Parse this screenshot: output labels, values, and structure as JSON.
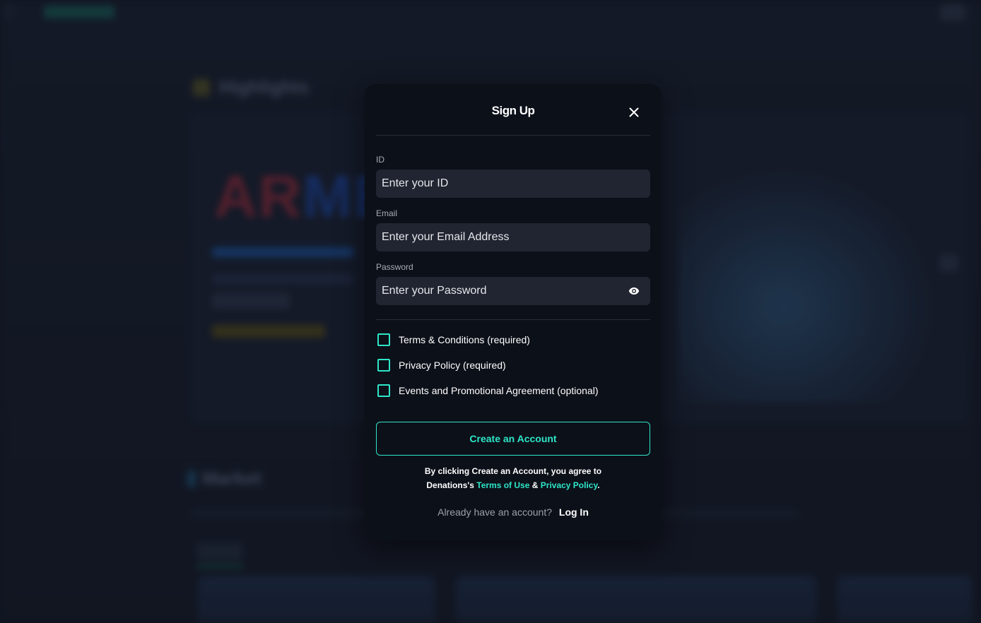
{
  "background": {
    "section_title_1": "Highlights",
    "hero_word_red": "AR",
    "hero_word_blue": "ME",
    "section_title_2": "Market"
  },
  "modal": {
    "title": "Sign Up",
    "close_icon": "close-icon",
    "fields": {
      "id": {
        "label": "ID",
        "placeholder": "Enter your ID",
        "value": ""
      },
      "email": {
        "label": "Email",
        "placeholder": "Enter your Email Address",
        "value": ""
      },
      "password": {
        "label": "Password",
        "placeholder": "Enter your Password",
        "value": "",
        "toggle_icon": "eye-icon"
      }
    },
    "agreements": [
      {
        "label": "Terms & Conditions (required)",
        "checked": false
      },
      {
        "label": "Privacy Policy (required)",
        "checked": false
      },
      {
        "label": "Events and Promotional Agreement (optional)",
        "checked": false
      }
    ],
    "create_button": "Create an Account",
    "legal": {
      "line1": "By clicking Create an Account, you agree to",
      "prefix": "Denations's",
      "terms_link": "Terms of Use",
      "amp": "&",
      "privacy_link": "Privacy Policy",
      "suffix": "."
    },
    "login": {
      "question": "Already have an account?",
      "link": "Log In"
    }
  },
  "colors": {
    "accent": "#2ee6c8",
    "modal_bg": "#0c1019",
    "input_bg": "#212531"
  }
}
